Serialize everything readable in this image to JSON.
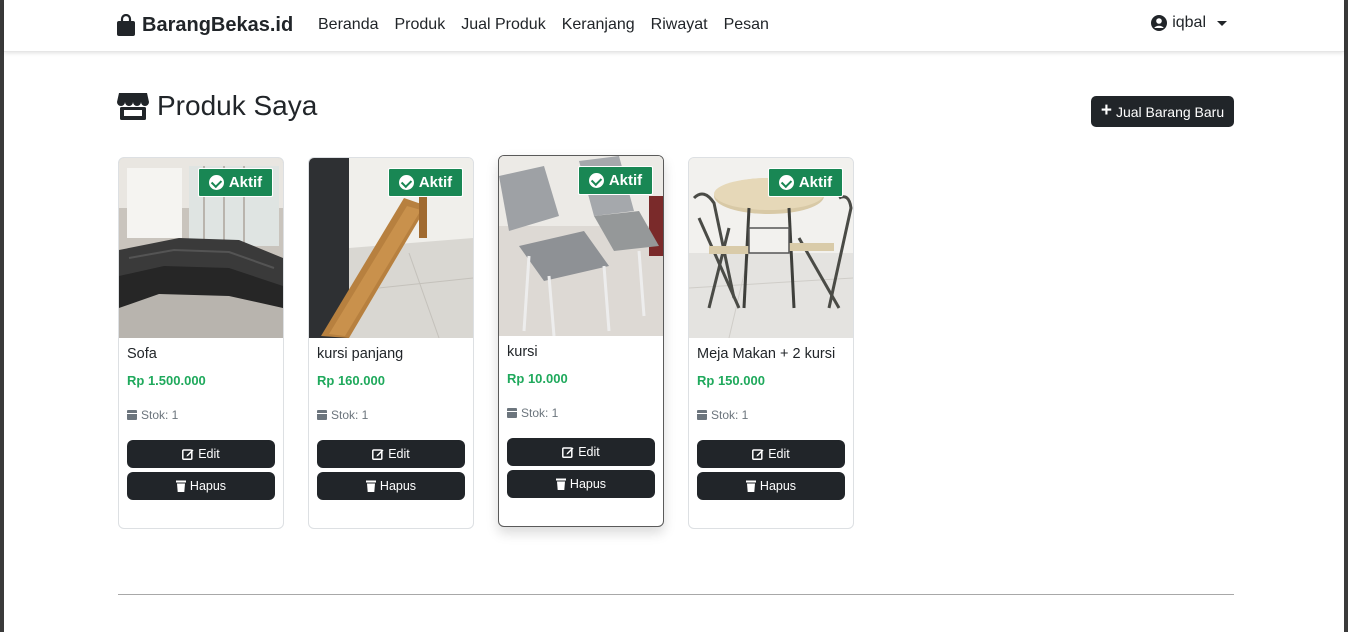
{
  "navbar": {
    "brand": "BarangBekas.id",
    "brand_icon": "shopping-bag-icon",
    "links": [
      "Beranda",
      "Produk",
      "Jual Produk",
      "Keranjang",
      "Riwayat",
      "Pesan"
    ],
    "user": "iqbal"
  },
  "header": {
    "title": "Produk Saya",
    "title_icon": "store-icon",
    "new_button": "Jual Barang Baru"
  },
  "colors": {
    "dark": "#212529",
    "success": "#198754",
    "price": "#1fa95c",
    "muted": "#6c757d"
  },
  "products": [
    {
      "name": "Sofa",
      "price": "Rp 1.500.000",
      "stock": "Stok: 1",
      "status": "Aktif",
      "edit": "Edit",
      "delete": "Hapus"
    },
    {
      "name": "kursi panjang",
      "price": "Rp 160.000",
      "stock": "Stok: 1",
      "status": "Aktif",
      "edit": "Edit",
      "delete": "Hapus"
    },
    {
      "name": "kursi",
      "price": "Rp 10.000",
      "stock": "Stok: 1",
      "status": "Aktif",
      "edit": "Edit",
      "delete": "Hapus"
    },
    {
      "name": "Meja Makan + 2 kursi",
      "price": "Rp 150.000",
      "stock": "Stok: 1",
      "status": "Aktif",
      "edit": "Edit",
      "delete": "Hapus"
    }
  ]
}
